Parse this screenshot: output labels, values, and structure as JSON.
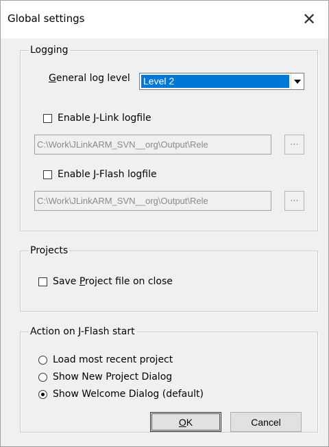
{
  "window": {
    "title": "Global settings",
    "close_glyph": "✕"
  },
  "logging": {
    "legend": "Logging",
    "log_level_label_prefix": "",
    "log_level_label_mnemonic": "G",
    "log_level_label_rest": "eneral log level",
    "log_level_value": "Level 2",
    "jlink_label_pre": "Enable ",
    "jlink_label_mnemonic": "J",
    "jlink_label_rest": "-Link logfile",
    "jlink_path": "C:\\Work\\JLinkARM_SVN__org\\Output\\Rele",
    "jflash_label": "Enable J-Flash logfile",
    "jflash_path": "C:\\Work\\JLinkARM_SVN__org\\Output\\Rele",
    "browse_label": "..."
  },
  "projects": {
    "legend": "Projects",
    "save_label_pre": "Save ",
    "save_label_mnemonic": "P",
    "save_label_rest": "roject file on close"
  },
  "startup": {
    "legend": "Action on J-Flash start",
    "options": [
      {
        "label": "Load most recent project",
        "selected": false
      },
      {
        "label": "Show New Project Dialog",
        "selected": false
      },
      {
        "label": "Show Welcome Dialog (default)",
        "selected": true
      }
    ]
  },
  "buttons": {
    "ok_mnemonic": "O",
    "ok_rest": "K",
    "cancel": "Cancel"
  },
  "icons": {
    "dropdown": "chevron-down-icon",
    "close": "close-icon"
  }
}
